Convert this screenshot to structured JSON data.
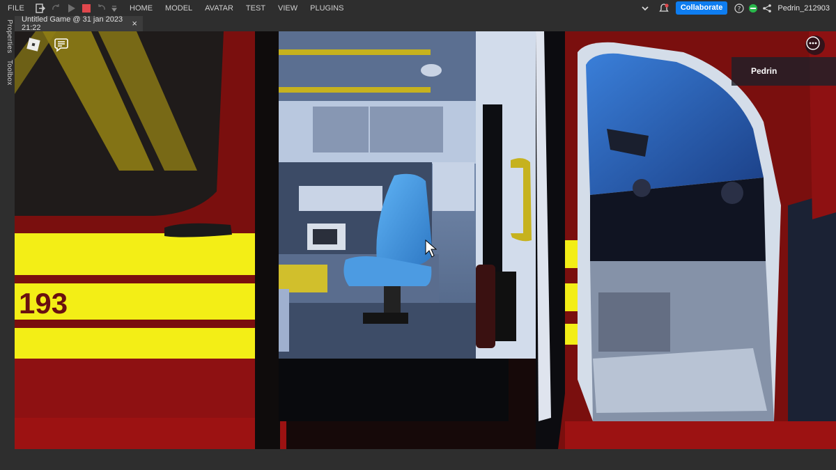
{
  "menubar": {
    "file": "FILE",
    "tabs": [
      "HOME",
      "MODEL",
      "AVATAR",
      "TEST",
      "VIEW",
      "PLUGINS"
    ],
    "collaborate": "Collaborate",
    "username": "Pedrin_212903"
  },
  "tab": {
    "title": "Untitled Game @ 31 jan 2023 21:22",
    "close": "×"
  },
  "side": {
    "properties": "Properties",
    "toolbox": "Toolbox"
  },
  "viewport": {
    "player_name": "Pedrin",
    "vehicle_number": "193"
  },
  "colors": {
    "accent": "#0e7df0",
    "status": "#28b84b",
    "stop": "#e0474c"
  }
}
